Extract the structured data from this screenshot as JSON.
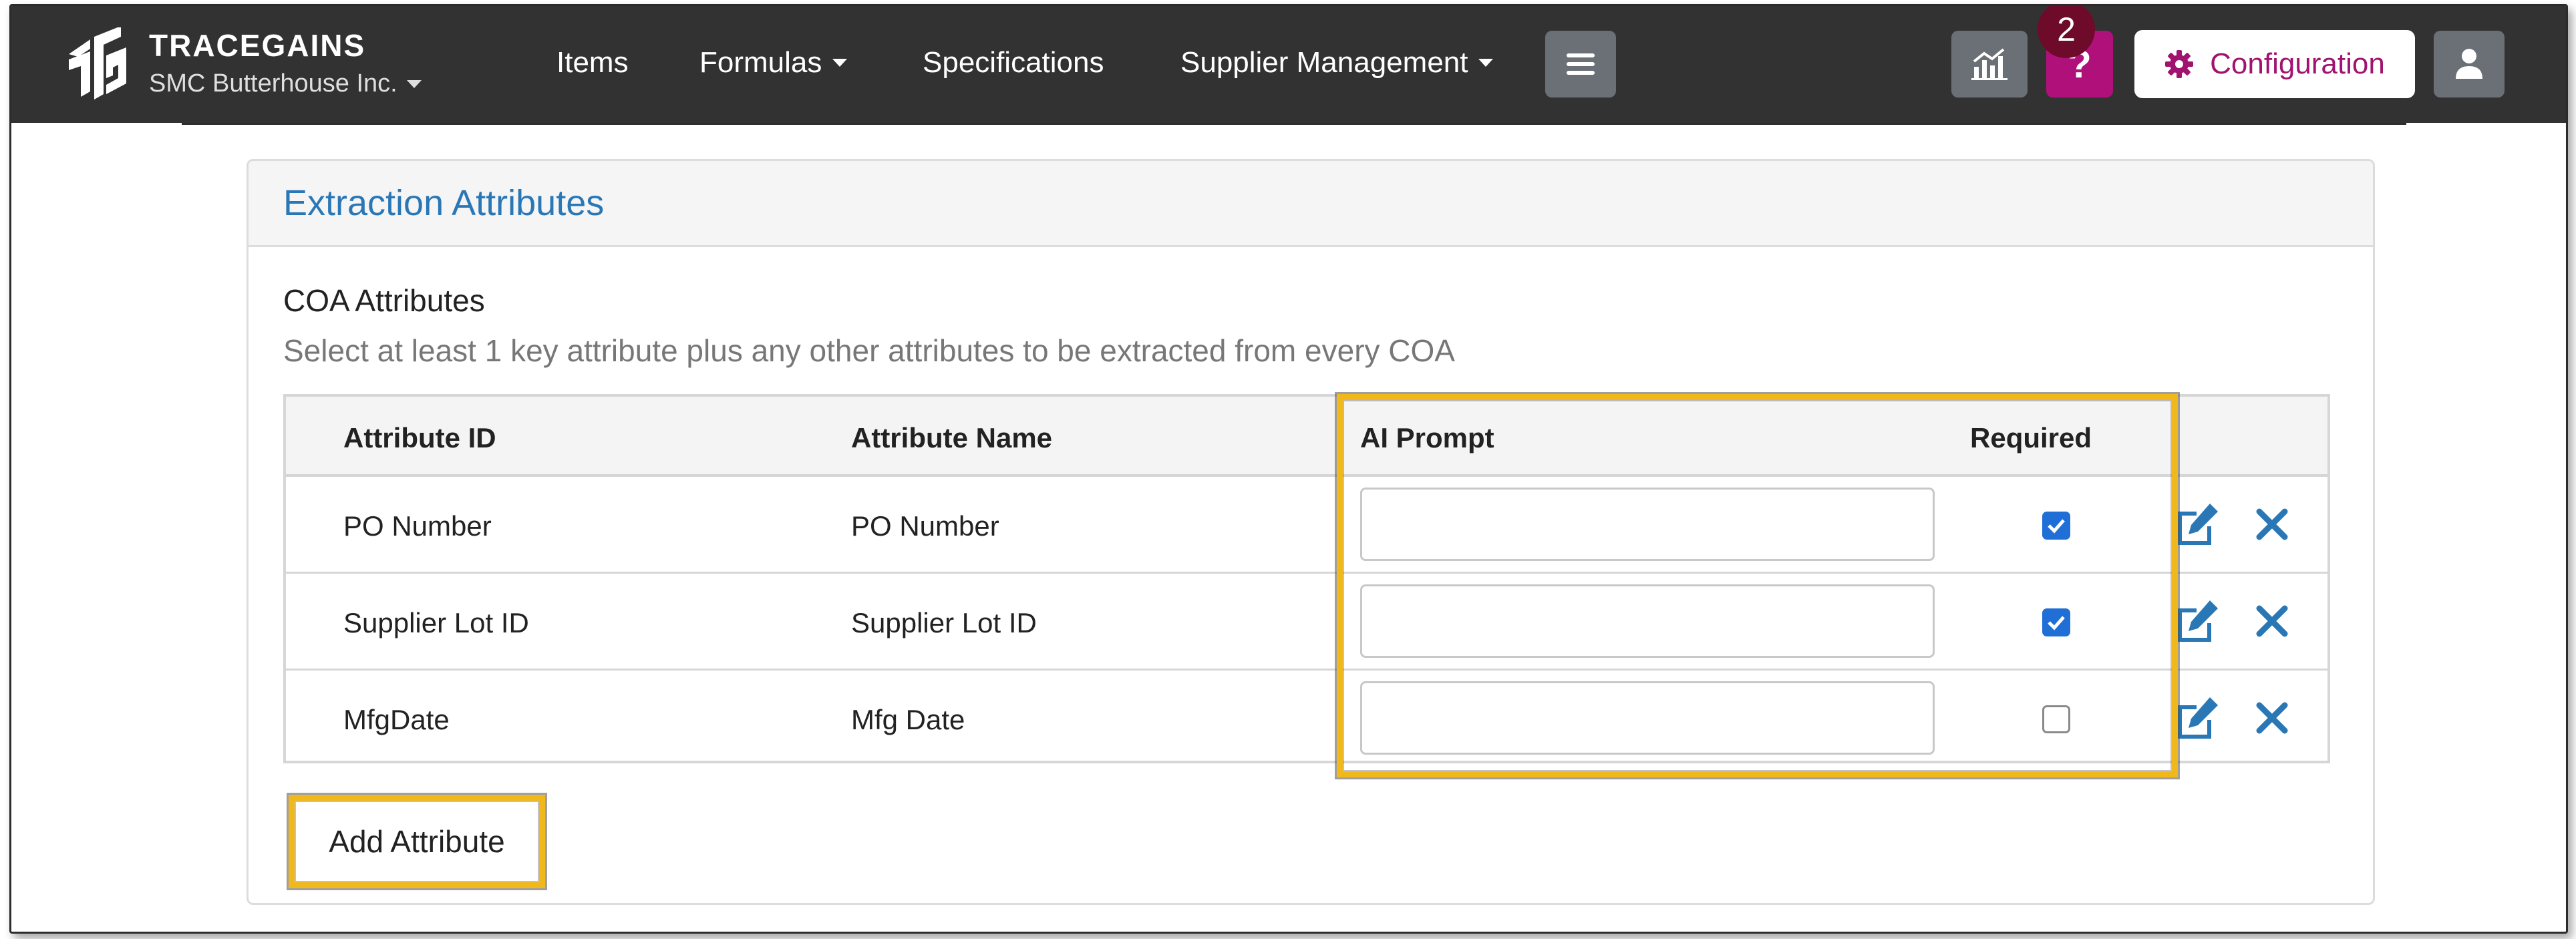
{
  "navbar": {
    "brand_name": "TRACEGAINS",
    "company": "SMC Butterhouse Inc.",
    "links": {
      "items": "Items",
      "formulas": "Formulas",
      "specifications": "Specifications",
      "supplier_management": "Supplier Management"
    },
    "help_label": "?",
    "notification_count": "2",
    "configuration_label": "Configuration",
    "icons": [
      "logo-icon",
      "menu-icon",
      "analytics-icon",
      "help-icon",
      "gear-icon",
      "user-icon"
    ]
  },
  "panel": {
    "title": "Extraction Attributes",
    "section_title": "COA Attributes",
    "section_description": "Select at least 1 key attribute plus any other attributes to be extracted from every COA"
  },
  "table": {
    "headers": {
      "attribute_id": "Attribute ID",
      "attribute_name": "Attribute Name",
      "ai_prompt": "AI Prompt",
      "required": "Required"
    },
    "rows": [
      {
        "attribute_id": "PO Number",
        "attribute_name": "PO Number",
        "ai_prompt": "",
        "required": true
      },
      {
        "attribute_id": "Supplier Lot ID",
        "attribute_name": "Supplier Lot ID",
        "ai_prompt": "",
        "required": true
      },
      {
        "attribute_id": "MfgDate",
        "attribute_name": "Mfg Date",
        "ai_prompt": "",
        "required": false
      }
    ]
  },
  "actions": {
    "add_attribute": "Add Attribute"
  },
  "colors": {
    "navbar": "#323232",
    "help_button": "#b0107a",
    "configuration_text": "#a01470",
    "link_blue": "#2a77b6",
    "highlight": "#f1b81b"
  }
}
